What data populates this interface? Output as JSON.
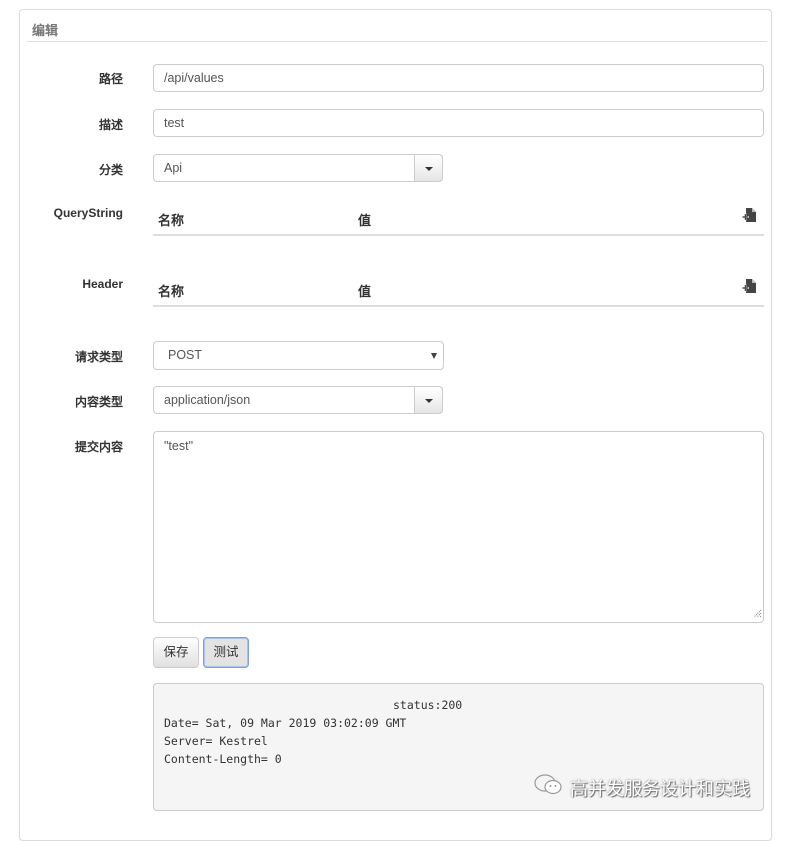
{
  "panel": {
    "title": "编辑"
  },
  "form": {
    "path": {
      "label": "路径",
      "value": "/api/values"
    },
    "description": {
      "label": "描述",
      "value": "test"
    },
    "category": {
      "label": "分类",
      "value": "Api"
    },
    "query_string": {
      "label": "QueryString",
      "col_name": "名称",
      "col_value": "值",
      "add_icon": "add-file-icon"
    },
    "header": {
      "label": "Header",
      "col_name": "名称",
      "col_value": "值",
      "add_icon": "add-file-icon"
    },
    "request_type": {
      "label": "请求类型",
      "value": "POST"
    },
    "content_type": {
      "label": "内容类型",
      "value": "application/json"
    },
    "body": {
      "label": "提交内容",
      "value": "\"test\""
    }
  },
  "buttons": {
    "save": "保存",
    "test": "测试"
  },
  "result": {
    "status": "status:200",
    "lines": [
      "Date= Sat, 09 Mar 2019 03:02:09 GMT",
      "Server= Kestrel",
      "Content-Length= 0"
    ]
  },
  "watermark": {
    "text": "高并发服务设计和实践",
    "icon": "wechat-icon"
  }
}
